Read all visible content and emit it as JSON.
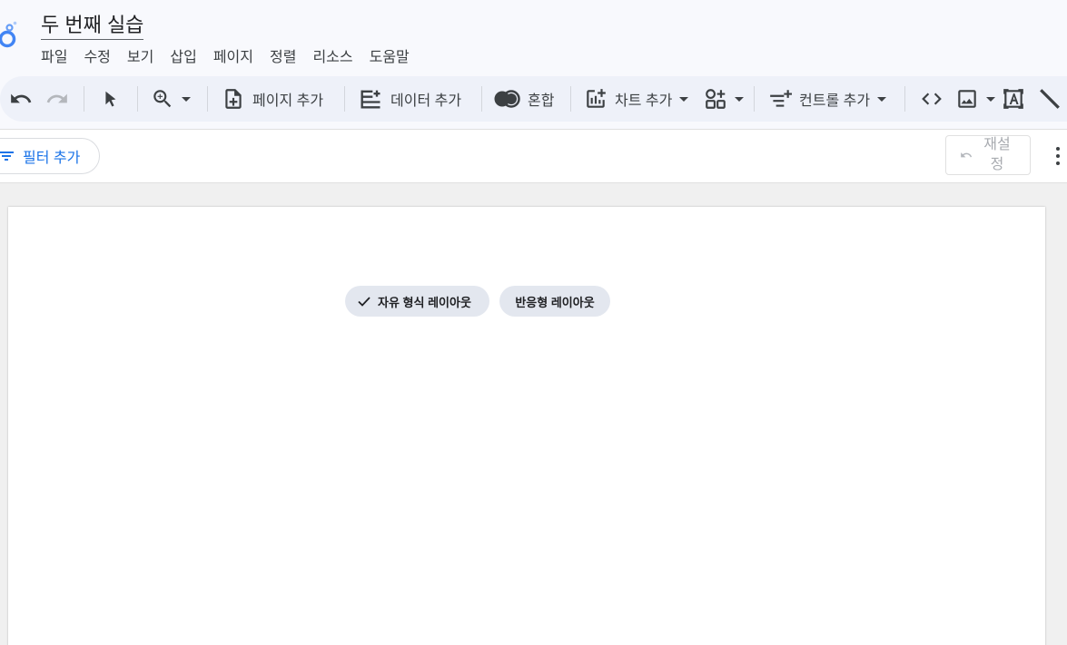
{
  "app": {
    "title": "두 번째 실습",
    "logo_icon": "looker-studio-logo-icon",
    "accent": "#1a73e8"
  },
  "menu": {
    "items": [
      {
        "label": "파일"
      },
      {
        "label": "수정"
      },
      {
        "label": "보기"
      },
      {
        "label": "삽입"
      },
      {
        "label": "페이지"
      },
      {
        "label": "정렬"
      },
      {
        "label": "리소스"
      },
      {
        "label": "도움말"
      }
    ]
  },
  "toolbar": {
    "add_page_label": "페이지 추가",
    "add_data_label": "데이터 추가",
    "blend_label": "혼합",
    "add_chart_label": "차트 추가",
    "add_control_label": "컨트롤 추가"
  },
  "filterbar": {
    "add_filter_label": "필터 추가",
    "reset_label": "재설정"
  },
  "canvas": {
    "layout_options": [
      {
        "label": "자유 형식 레이아웃",
        "selected": true
      },
      {
        "label": "반응형 레이아웃",
        "selected": false
      }
    ]
  }
}
